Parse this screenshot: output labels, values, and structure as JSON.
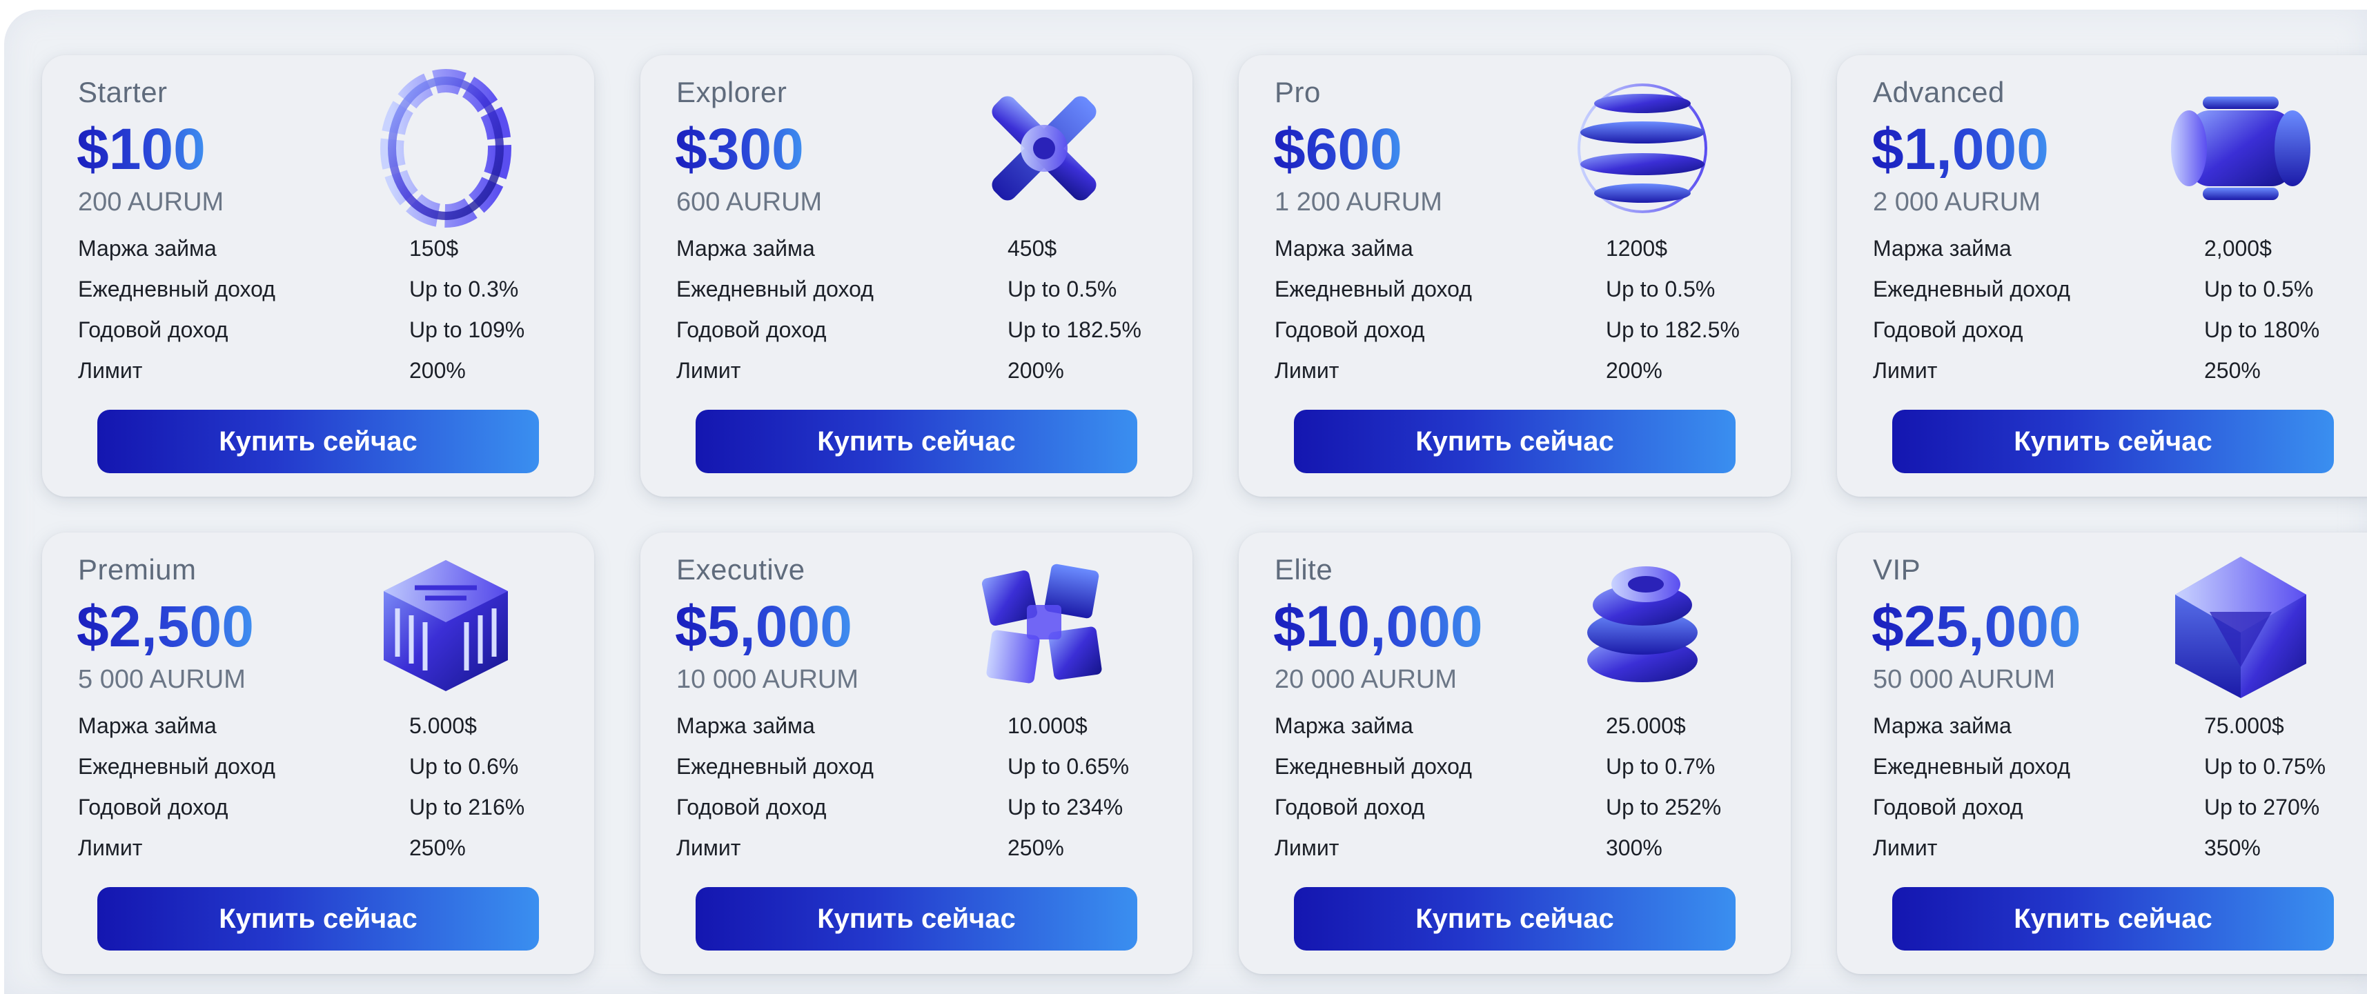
{
  "plans": [
    {
      "name": "Starter",
      "price": "$100",
      "aurum": "200 AURUM",
      "icon": "twisted-ring-icon",
      "rows": [
        {
          "label": "Маржа займа",
          "value": "150$"
        },
        {
          "label": "Ежедневный доход",
          "value": "Up to 0.3%"
        },
        {
          "label": "Годовой доход",
          "value": "Up to 109%"
        },
        {
          "label": "Лимит",
          "value": "200%"
        }
      ],
      "button": "Купить сейчас"
    },
    {
      "name": "Explorer",
      "price": "$300",
      "aurum": "600 AURUM",
      "icon": "cross-connector-icon",
      "rows": [
        {
          "label": "Маржа займа",
          "value": "450$"
        },
        {
          "label": "Ежедневный доход",
          "value": "Up to 0.5%"
        },
        {
          "label": "Годовой доход",
          "value": "Up to 182.5%"
        },
        {
          "label": "Лимит",
          "value": "200%"
        }
      ],
      "button": "Купить сейчас"
    },
    {
      "name": "Pro",
      "price": "$600",
      "aurum": "1 200 AURUM",
      "icon": "striped-sphere-icon",
      "rows": [
        {
          "label": "Маржа займа",
          "value": "1200$"
        },
        {
          "label": "Ежедневный доход",
          "value": "Up to 0.5%"
        },
        {
          "label": "Годовой доход",
          "value": "Up to 182.5%"
        },
        {
          "label": "Лимит",
          "value": "200%"
        }
      ],
      "button": "Купить сейчас"
    },
    {
      "name": "Advanced",
      "price": "$1,000",
      "aurum": "2 000 AURUM",
      "icon": "cylinder-capsule-icon",
      "rows": [
        {
          "label": "Маржа займа",
          "value": "2,000$"
        },
        {
          "label": "Ежедневный доход",
          "value": "Up to 0.5%"
        },
        {
          "label": "Годовой доход",
          "value": "Up to 180%"
        },
        {
          "label": "Лимит",
          "value": "250%"
        }
      ],
      "button": "Купить сейчас"
    },
    {
      "name": "Premium",
      "price": "$2,500",
      "aurum": "5 000 AURUM",
      "icon": "maze-cube-icon",
      "rows": [
        {
          "label": "Маржа займа",
          "value": "5.000$"
        },
        {
          "label": "Ежедневный доход",
          "value": "Up to 0.6%"
        },
        {
          "label": "Годовой доход",
          "value": "Up to 216%"
        },
        {
          "label": "Лимит",
          "value": "250%"
        }
      ],
      "button": "Купить сейчас"
    },
    {
      "name": "Executive",
      "price": "$5,000",
      "aurum": "10 000 AURUM",
      "icon": "fragmented-cube-icon",
      "rows": [
        {
          "label": "Маржа займа",
          "value": "10.000$"
        },
        {
          "label": "Ежедневный доход",
          "value": "Up to 0.65%"
        },
        {
          "label": "Годовой доход",
          "value": "Up to 234%"
        },
        {
          "label": "Лимит",
          "value": "250%"
        }
      ],
      "button": "Купить сейчас"
    },
    {
      "name": "Elite",
      "price": "$10,000",
      "aurum": "20 000 AURUM",
      "icon": "stacked-rings-icon",
      "rows": [
        {
          "label": "Маржа займа",
          "value": "25.000$"
        },
        {
          "label": "Ежедневный доход",
          "value": "Up to 0.7%"
        },
        {
          "label": "Годовой доход",
          "value": "Up to 252%"
        },
        {
          "label": "Лимит",
          "value": "300%"
        }
      ],
      "button": "Купить сейчас"
    },
    {
      "name": "VIP",
      "price": "$25,000",
      "aurum": "50 000 AURUM",
      "icon": "crystal-cube-icon",
      "rows": [
        {
          "label": "Маржа займа",
          "value": "75.000$"
        },
        {
          "label": "Ежедневный доход",
          "value": "Up to 0.75%"
        },
        {
          "label": "Годовой доход",
          "value": "Up to 270%"
        },
        {
          "label": "Лимит",
          "value": "350%"
        }
      ],
      "button": "Купить сейчас"
    }
  ]
}
